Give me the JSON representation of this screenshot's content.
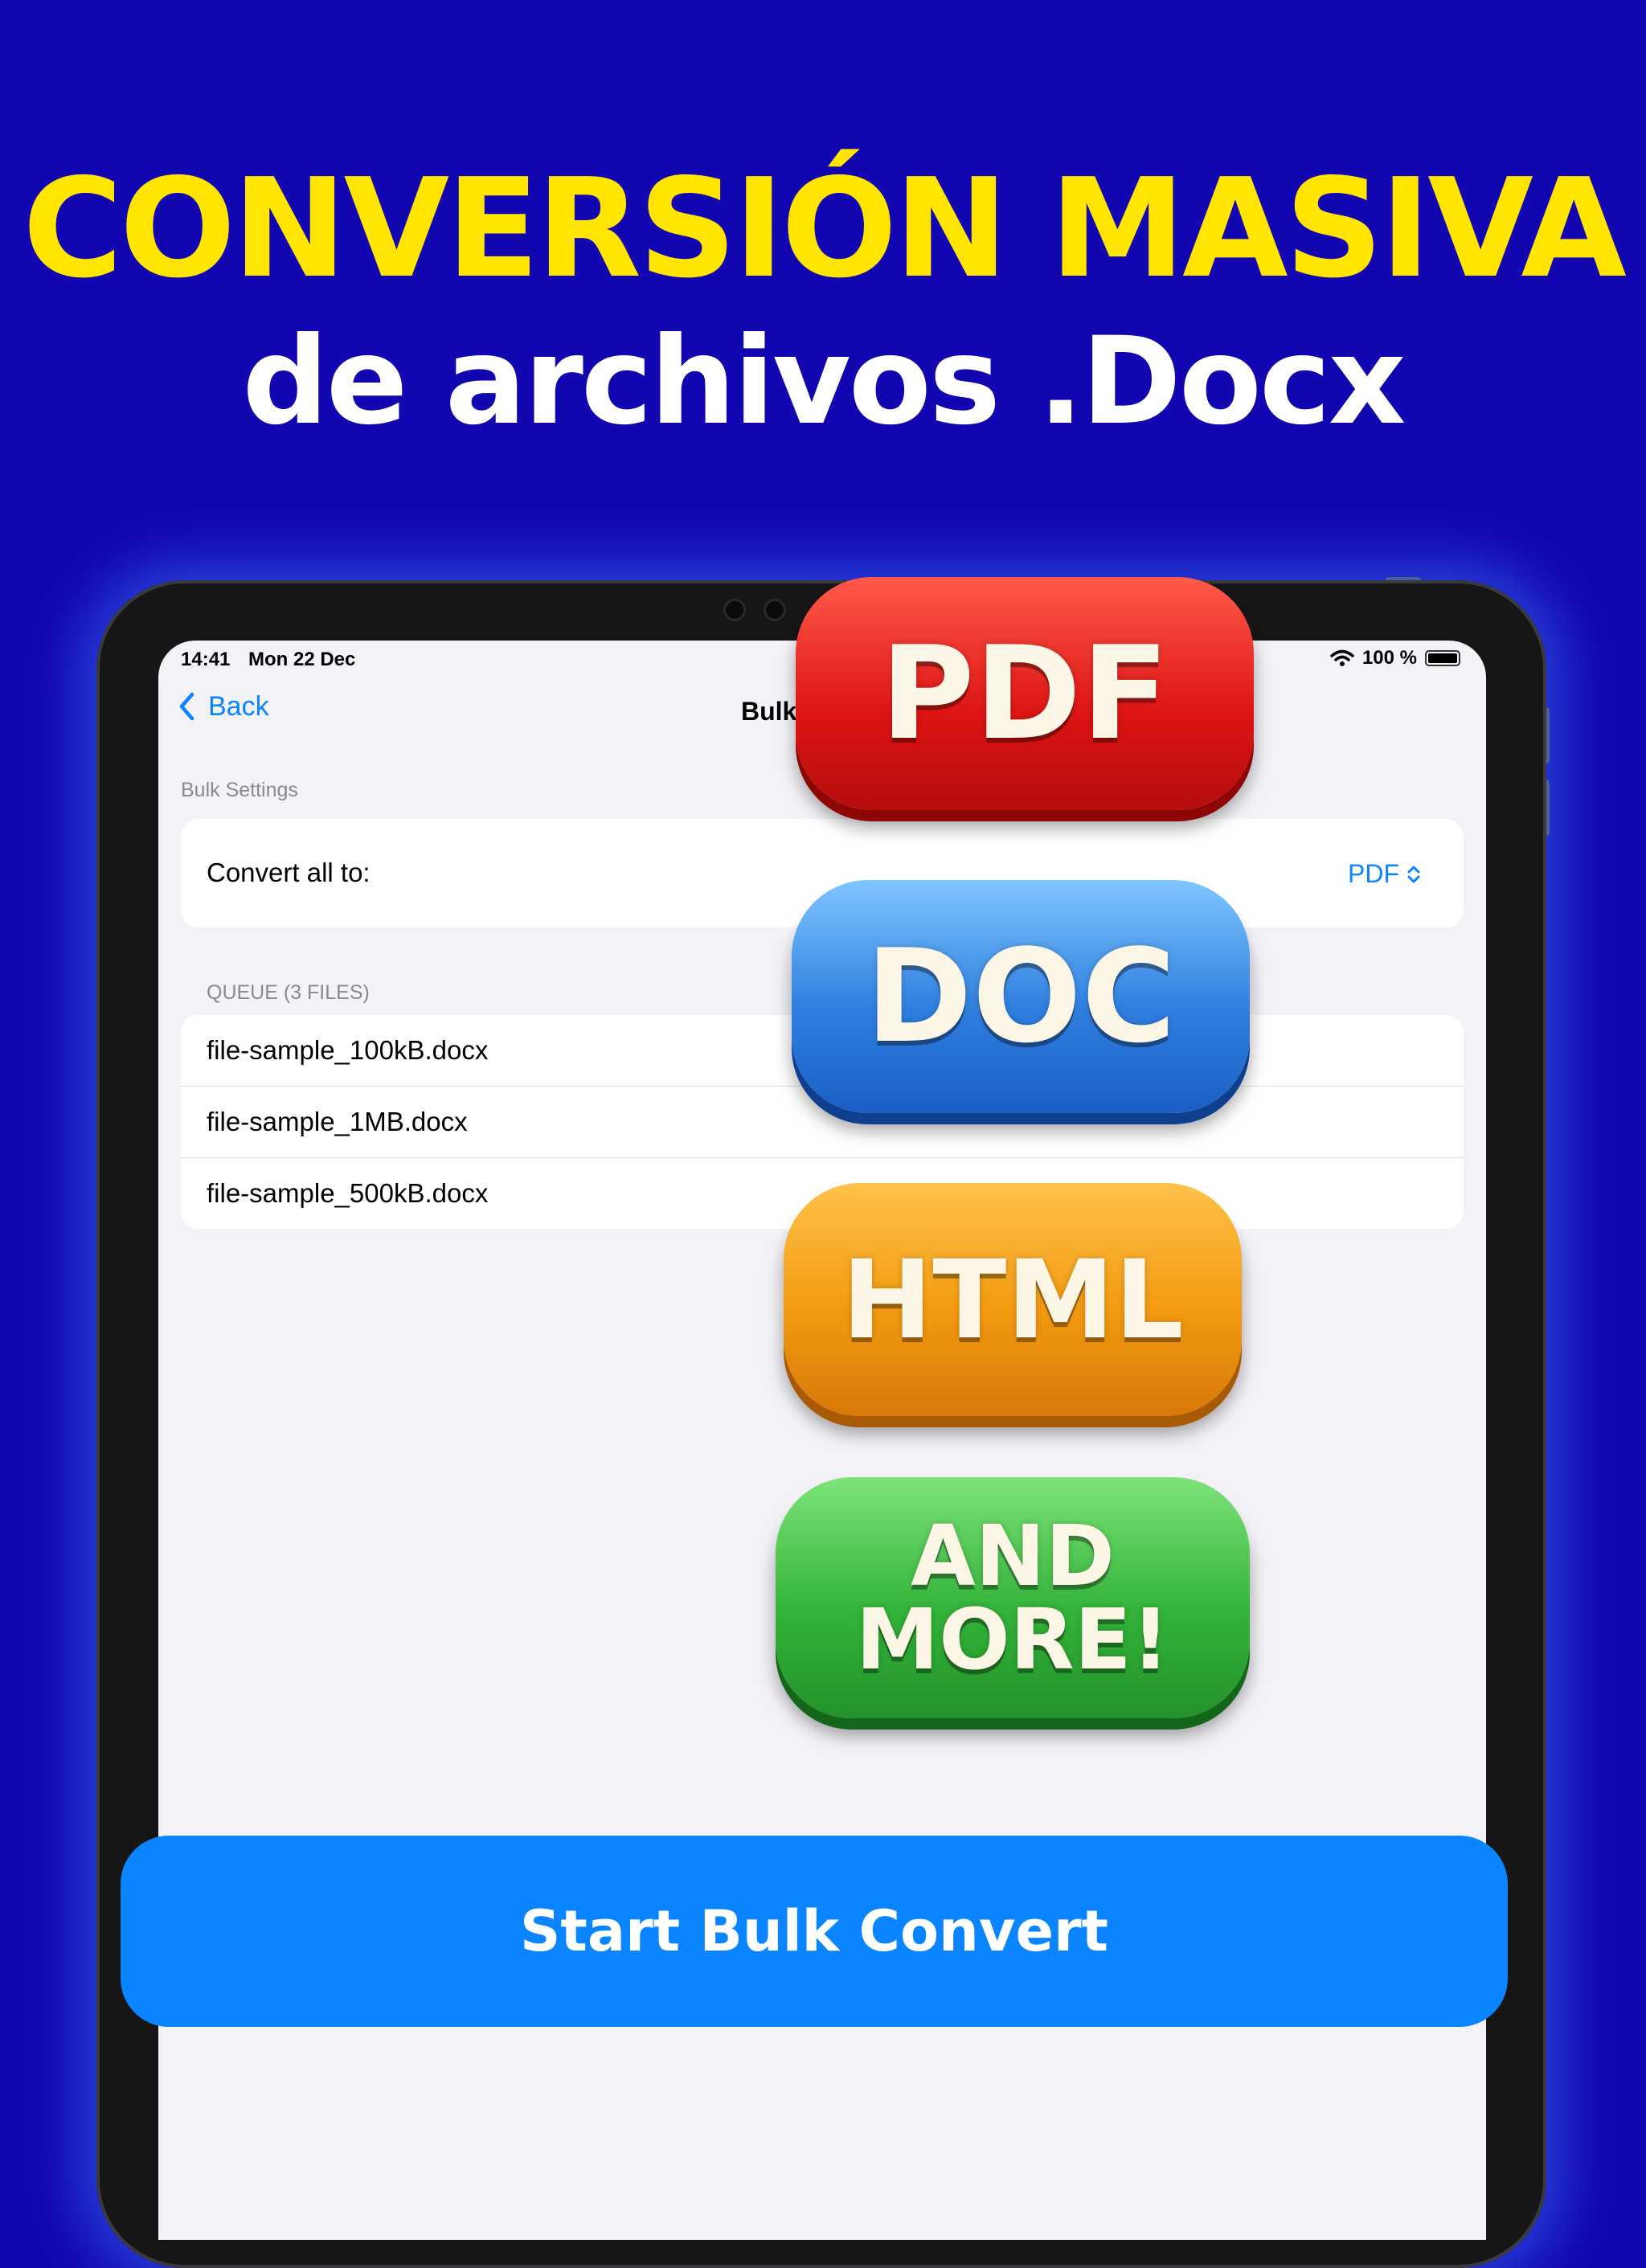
{
  "headline": {
    "line1": "CONVERSIÓN MASIVA",
    "line2": "de archivos .Docx"
  },
  "status_bar": {
    "time": "14:41",
    "date": "Mon 22 Dec",
    "battery": "100 %"
  },
  "nav": {
    "back_label": "Back",
    "title": "Bulk"
  },
  "bulk_settings": {
    "section_label": "Bulk Settings",
    "convert_label": "Convert all to:",
    "selected_format": "PDF"
  },
  "queue": {
    "section_label": "QUEUE (3 FILES)",
    "files": [
      "file-sample_100kB.docx",
      "file-sample_1MB.docx",
      "file-sample_500kB.docx"
    ]
  },
  "start_button_label": "Start Bulk Convert",
  "badges": {
    "pdf": "PDF",
    "doc": "DOC",
    "html": "HTML",
    "more_line1": "AND",
    "more_line2": "MORE!"
  },
  "colors": {
    "background": "#1206b0",
    "headline_yellow": "#ffe500",
    "accent_blue": "#0a84ff"
  }
}
